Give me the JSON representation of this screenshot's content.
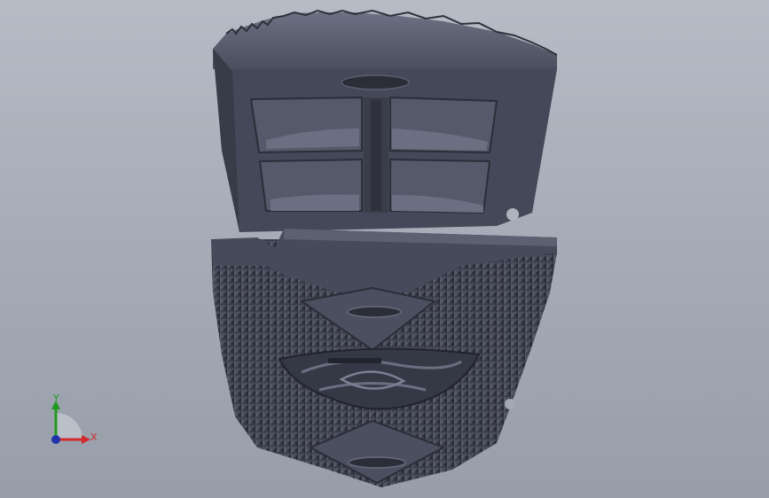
{
  "viewport": {
    "background_top": "#b6bcc6",
    "background_bottom": "#979ea9"
  },
  "model": {
    "description_icon": "3d-part-icon",
    "base_color": "#3f4250",
    "highlight_color": "#5a5e6f",
    "shadow_color": "#2a2c36"
  },
  "triad": {
    "x_label": "X",
    "y_label": "Y",
    "x_color": "#d22a2a",
    "y_color": "#1f9a1f",
    "z_color": "#2233aa"
  }
}
